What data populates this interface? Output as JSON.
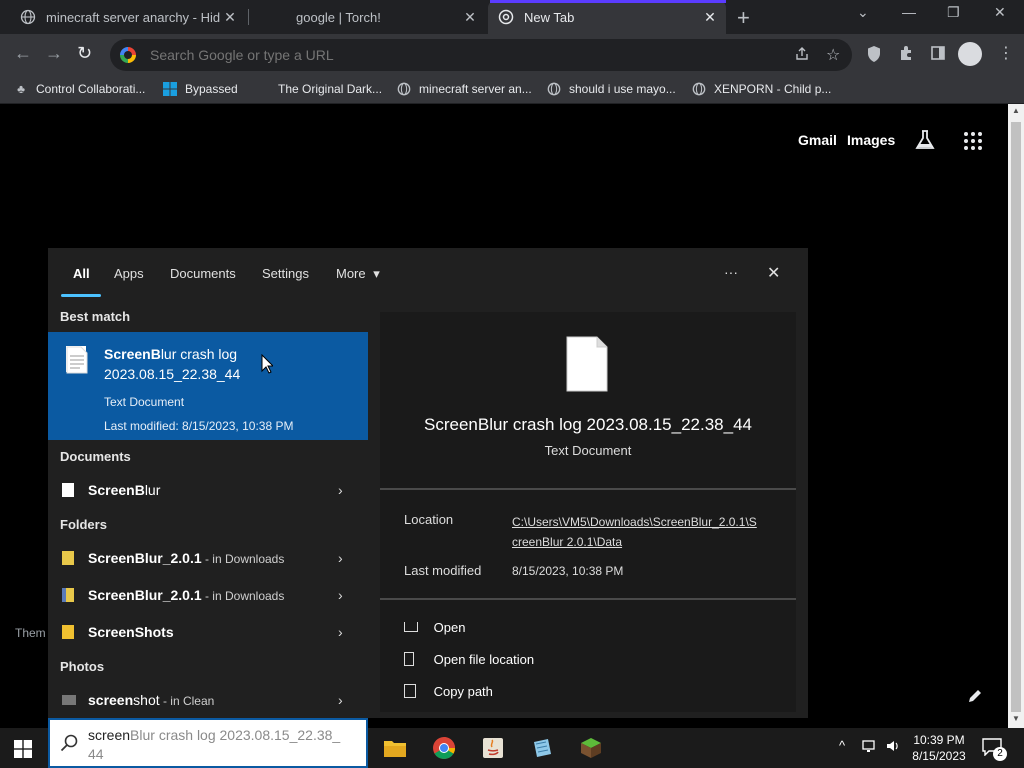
{
  "tabs": [
    {
      "title": "minecraft server anarchy - Hidde",
      "close": "✕"
    },
    {
      "title": "google | Torch!",
      "close": "✕"
    },
    {
      "title": "New Tab",
      "close": "✕"
    }
  ],
  "newtab_symbol": "+",
  "window_controls": {
    "chevron": "⌄",
    "minimize": "—",
    "restore": "❐",
    "close": "✕"
  },
  "omnibox": {
    "placeholder": "Search Google or type a URL"
  },
  "bookmarks": [
    {
      "label": "Control Collaborati..."
    },
    {
      "label": "Bypassed"
    },
    {
      "label": "The Original Dark..."
    },
    {
      "label": "minecraft server an..."
    },
    {
      "label": "should i use mayo..."
    },
    {
      "label": "XENPORN - Child p..."
    }
  ],
  "google_header": {
    "gmail": "Gmail",
    "images": "Images"
  },
  "page_fragment": "Them",
  "search_panel": {
    "tabs": [
      "All",
      "Apps",
      "Documents",
      "Settings",
      "More"
    ],
    "more_caret": "▾",
    "ellipsis": "···",
    "close": "✕",
    "best_match_header": "Best match",
    "best_match": {
      "title_bold": "ScreenB",
      "title_rest": "lur crash log",
      "title_line2": "2023.08.15_22.38_44",
      "type": "Text Document",
      "modified": "Last modified: 8/15/2023, 10:38 PM"
    },
    "documents_header": "Documents",
    "documents": [
      {
        "name_bold": "ScreenB",
        "name_rest": "lur",
        "suffix": ""
      }
    ],
    "folders_header": "Folders",
    "folders": [
      {
        "name_bold": "ScreenB",
        "name_rest": "lur_2.0.1",
        "suffix": " - in Downloads"
      },
      {
        "name_bold": "ScreenB",
        "name_rest": "lur_2.0.1",
        "suffix": " - in Downloads"
      },
      {
        "name_bold": "ScreenS",
        "name_rest": "hots",
        "suffix": ""
      }
    ],
    "photos_header": "Photos",
    "photos": [
      {
        "name_bold": "screen",
        "name_rest": "shot",
        "suffix": " - in Clean"
      }
    ],
    "arrow": "›",
    "preview": {
      "title": "ScreenBlur crash log 2023.08.15_22.38_44",
      "type": "Text Document",
      "location_label": "Location",
      "location_value_1": "C:\\Users\\VM5\\Downloads\\ScreenBlur_2.0.1\\S",
      "location_value_2": "creenBlur 2.0.1\\Data",
      "modified_label": "Last modified",
      "modified_value": "8/15/2023, 10:38 PM",
      "actions": [
        "Open",
        "Open file location",
        "Copy path"
      ]
    }
  },
  "searchbox": {
    "typed": "screen",
    "ghost": "Blur crash log 2023.08.15_22.38_",
    "ghost_line2": "44"
  },
  "clock": {
    "time": "10:39 PM",
    "date": "8/15/2023"
  },
  "notification_count": "2"
}
